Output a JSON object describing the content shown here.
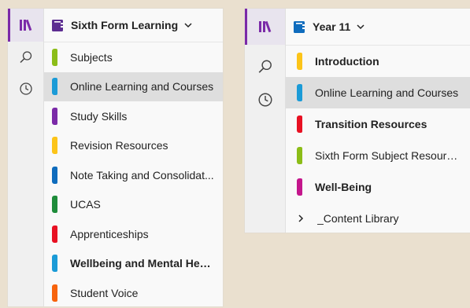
{
  "left_panel": {
    "notebook_title": "Sixth Form Learning",
    "notebook_color": "#5c2d91",
    "sections": [
      {
        "label": "Subjects",
        "color": "#8cbd18",
        "bold": false,
        "selected": false
      },
      {
        "label": "Online Learning and Courses",
        "color": "#1b9bd7",
        "bold": false,
        "selected": true
      },
      {
        "label": "Study Skills",
        "color": "#7b2aa8",
        "bold": false,
        "selected": false
      },
      {
        "label": "Revision Resources",
        "color": "#fcc419",
        "bold": false,
        "selected": false
      },
      {
        "label": "Note Taking and Consolidat...",
        "color": "#0f6cbd",
        "bold": false,
        "selected": false
      },
      {
        "label": "UCAS",
        "color": "#1e8c3a",
        "bold": false,
        "selected": false
      },
      {
        "label": "Apprenticeships",
        "color": "#e81123",
        "bold": false,
        "selected": false
      },
      {
        "label": "Wellbeing and Mental Hea...",
        "color": "#1b9bd7",
        "bold": true,
        "selected": false
      },
      {
        "label": "Student Voice",
        "color": "#f7630c",
        "bold": false,
        "selected": false
      }
    ]
  },
  "right_panel": {
    "notebook_title": "Year 11",
    "notebook_color": "#0f6cbd",
    "sections": [
      {
        "label": "Introduction",
        "color": "#fcc419",
        "bold": true,
        "selected": false
      },
      {
        "label": "Online Learning and Courses",
        "color": "#1b9bd7",
        "bold": false,
        "selected": true
      },
      {
        "label": "Transition Resources",
        "color": "#e81123",
        "bold": true,
        "selected": false
      },
      {
        "label": "Sixth Form Subject Resources",
        "color": "#8cbd18",
        "bold": false,
        "selected": false
      },
      {
        "label": "Well-Being",
        "color": "#c4168c",
        "bold": true,
        "selected": false
      }
    ],
    "section_group": {
      "label": "_Content Library"
    }
  },
  "rail": {
    "icons": [
      "notebooks-icon",
      "search-icon",
      "recent-icon"
    ],
    "accent": "#7b2aa8"
  }
}
